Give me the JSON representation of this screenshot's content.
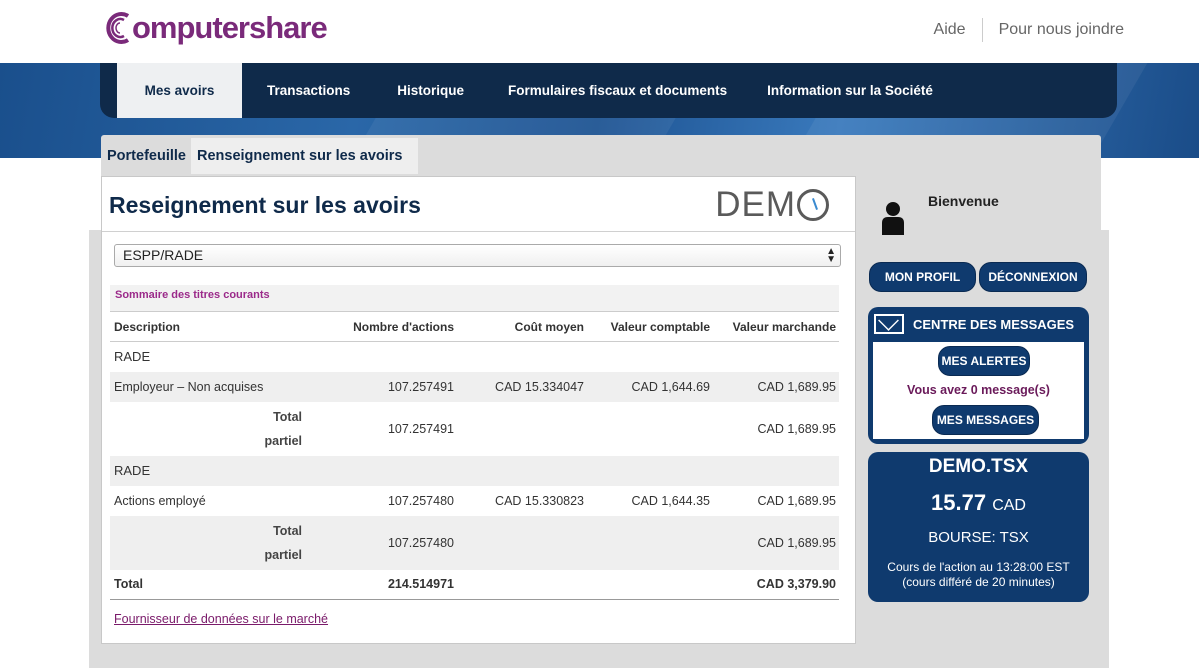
{
  "header": {
    "logo_text": "omputershare",
    "links": [
      "Aide",
      "Pour nous joindre"
    ]
  },
  "nav": {
    "items": [
      "Mes avoirs",
      "Transactions",
      "Historique",
      "Formulaires fiscaux et documents",
      "Information sur la Société"
    ]
  },
  "subtabs": [
    "Portefeuille",
    "Renseignement sur les avoirs"
  ],
  "panel": {
    "title": "Reseignement sur les avoirs",
    "demo_logo": "DEM",
    "plan_select": "ESPP/RADE",
    "summary_heading": "Sommaire des titres courants",
    "columns": [
      "Description",
      "Nombre d'actions",
      "Coût moyen",
      "Valeur comptable",
      "Valeur marchande"
    ],
    "groups": [
      {
        "name": "RADE",
        "row": {
          "description": "Employeur – Non acquises",
          "shares": "107.257491",
          "avg_cost": "CAD 15.334047",
          "book": "CAD 1,644.69",
          "market": "CAD 1,689.95"
        },
        "subtotal": {
          "label_line1": "Total",
          "label_line2": "partiel",
          "shares": "107.257491",
          "market": "CAD 1,689.95"
        }
      },
      {
        "name": "RADE",
        "row": {
          "description": "Actions employé",
          "shares": "107.257480",
          "avg_cost": "CAD 15.330823",
          "book": "CAD 1,644.35",
          "market": "CAD 1,689.95"
        },
        "subtotal": {
          "label_line1": "Total",
          "label_line2": "partiel",
          "shares": "107.257480",
          "market": "CAD 1,689.95"
        }
      }
    ],
    "total": {
      "label": "Total",
      "shares": "214.514971",
      "market": "CAD 3,379.90"
    },
    "vendor_link": "Fournisseur de données sur le marché"
  },
  "sidebar": {
    "welcome": "Bienvenue",
    "buttons": {
      "profile": "MON PROFIL",
      "logout": "DÉCONNEXION"
    },
    "messages": {
      "title": "CENTRE DES MESSAGES",
      "alerts_button": "MES ALERTES",
      "count_text": "Vous avez 0 message(s)",
      "messages_button": "MES MESSAGES"
    },
    "quote": {
      "symbol": "DEMO.TSX",
      "price": "15.77",
      "currency": "CAD",
      "exchange": "BOURSE: TSX",
      "time_line1": "Cours de l'action au 13:28:00 EST",
      "time_line2": "(cours différé de 20 minutes)"
    }
  },
  "colors": {
    "nav_bg": "#0f2a4a",
    "brand_purple": "#7a2a7a",
    "widget_blue": "#0f3a6e"
  }
}
